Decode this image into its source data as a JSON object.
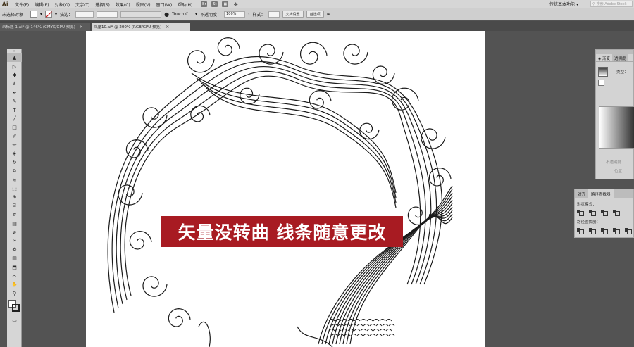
{
  "app": {
    "logo": "Ai"
  },
  "menu": [
    "文件(F)",
    "编辑(E)",
    "对象(O)",
    "文字(T)",
    "选择(S)",
    "效果(C)",
    "视图(V)",
    "窗口(W)",
    "帮助(H)"
  ],
  "menu_icons": [
    "Br",
    "St"
  ],
  "workspace": "传统基本功能",
  "stock_search": {
    "placeholder": "搜索 Adobe Stock"
  },
  "control": {
    "selection": "未选择对象",
    "stroke_label": "描边：",
    "brush": "Touch C...",
    "opacity_label": "不透明度：",
    "opacity_value": "100%",
    "style_label": "样式：",
    "doc_setup": "文档设置",
    "preferences": "首选项"
  },
  "tabs": [
    {
      "label": "未标题-1.ai* @ 146% (CMYK/GPU 预览)",
      "close": "×"
    },
    {
      "label": "凤凰10.ai* @ 200% (RGB/GPU 预览)",
      "close": "×"
    }
  ],
  "tools": [
    {
      "name": "selection-tool",
      "glyph": "▲"
    },
    {
      "name": "direct-selection-tool",
      "glyph": "▷"
    },
    {
      "name": "magic-wand-tool",
      "glyph": "✱"
    },
    {
      "name": "lasso-tool",
      "glyph": "ℓ"
    },
    {
      "name": "pen-tool",
      "glyph": "✒"
    },
    {
      "name": "curvature-tool",
      "glyph": "✎"
    },
    {
      "name": "type-tool",
      "glyph": "T"
    },
    {
      "name": "line-tool",
      "glyph": "╱"
    },
    {
      "name": "rectangle-tool",
      "glyph": "□"
    },
    {
      "name": "paintbrush-tool",
      "glyph": "✐"
    },
    {
      "name": "shaper-tool",
      "glyph": "✏"
    },
    {
      "name": "eraser-tool",
      "glyph": "◈"
    },
    {
      "name": "rotate-tool",
      "glyph": "↻"
    },
    {
      "name": "scale-tool",
      "glyph": "⧉"
    },
    {
      "name": "warp-tool",
      "glyph": "≋"
    },
    {
      "name": "free-transform-tool",
      "glyph": "⬚"
    },
    {
      "name": "shape-builder-tool",
      "glyph": "⊕"
    },
    {
      "name": "perspective-grid-tool",
      "glyph": "⌸"
    },
    {
      "name": "mesh-tool",
      "glyph": "#"
    },
    {
      "name": "gradient-tool",
      "glyph": "▤"
    },
    {
      "name": "eyedropper-tool",
      "glyph": "⌀"
    },
    {
      "name": "blend-tool",
      "glyph": "∞"
    },
    {
      "name": "symbol-sprayer-tool",
      "glyph": "❁"
    },
    {
      "name": "column-graph-tool",
      "glyph": "▥"
    },
    {
      "name": "artboard-tool",
      "glyph": "⬒"
    },
    {
      "name": "slice-tool",
      "glyph": "✂"
    },
    {
      "name": "hand-tool",
      "glyph": "✋"
    },
    {
      "name": "zoom-tool",
      "glyph": "⚲"
    }
  ],
  "banner": {
    "text": "矢量没转曲 线条随意更改",
    "color": "#a81b22"
  },
  "gradient_panel": {
    "tabs": [
      "渐变",
      "透明度"
    ],
    "type_label": "类型：",
    "opacity_label": "不透明度",
    "position_label": "位置"
  },
  "pathfinder_panel": {
    "tabs": [
      "对齐",
      "路径查找器"
    ],
    "shape_modes_label": "形状模式：",
    "pathfinders_label": "路径查找器："
  }
}
